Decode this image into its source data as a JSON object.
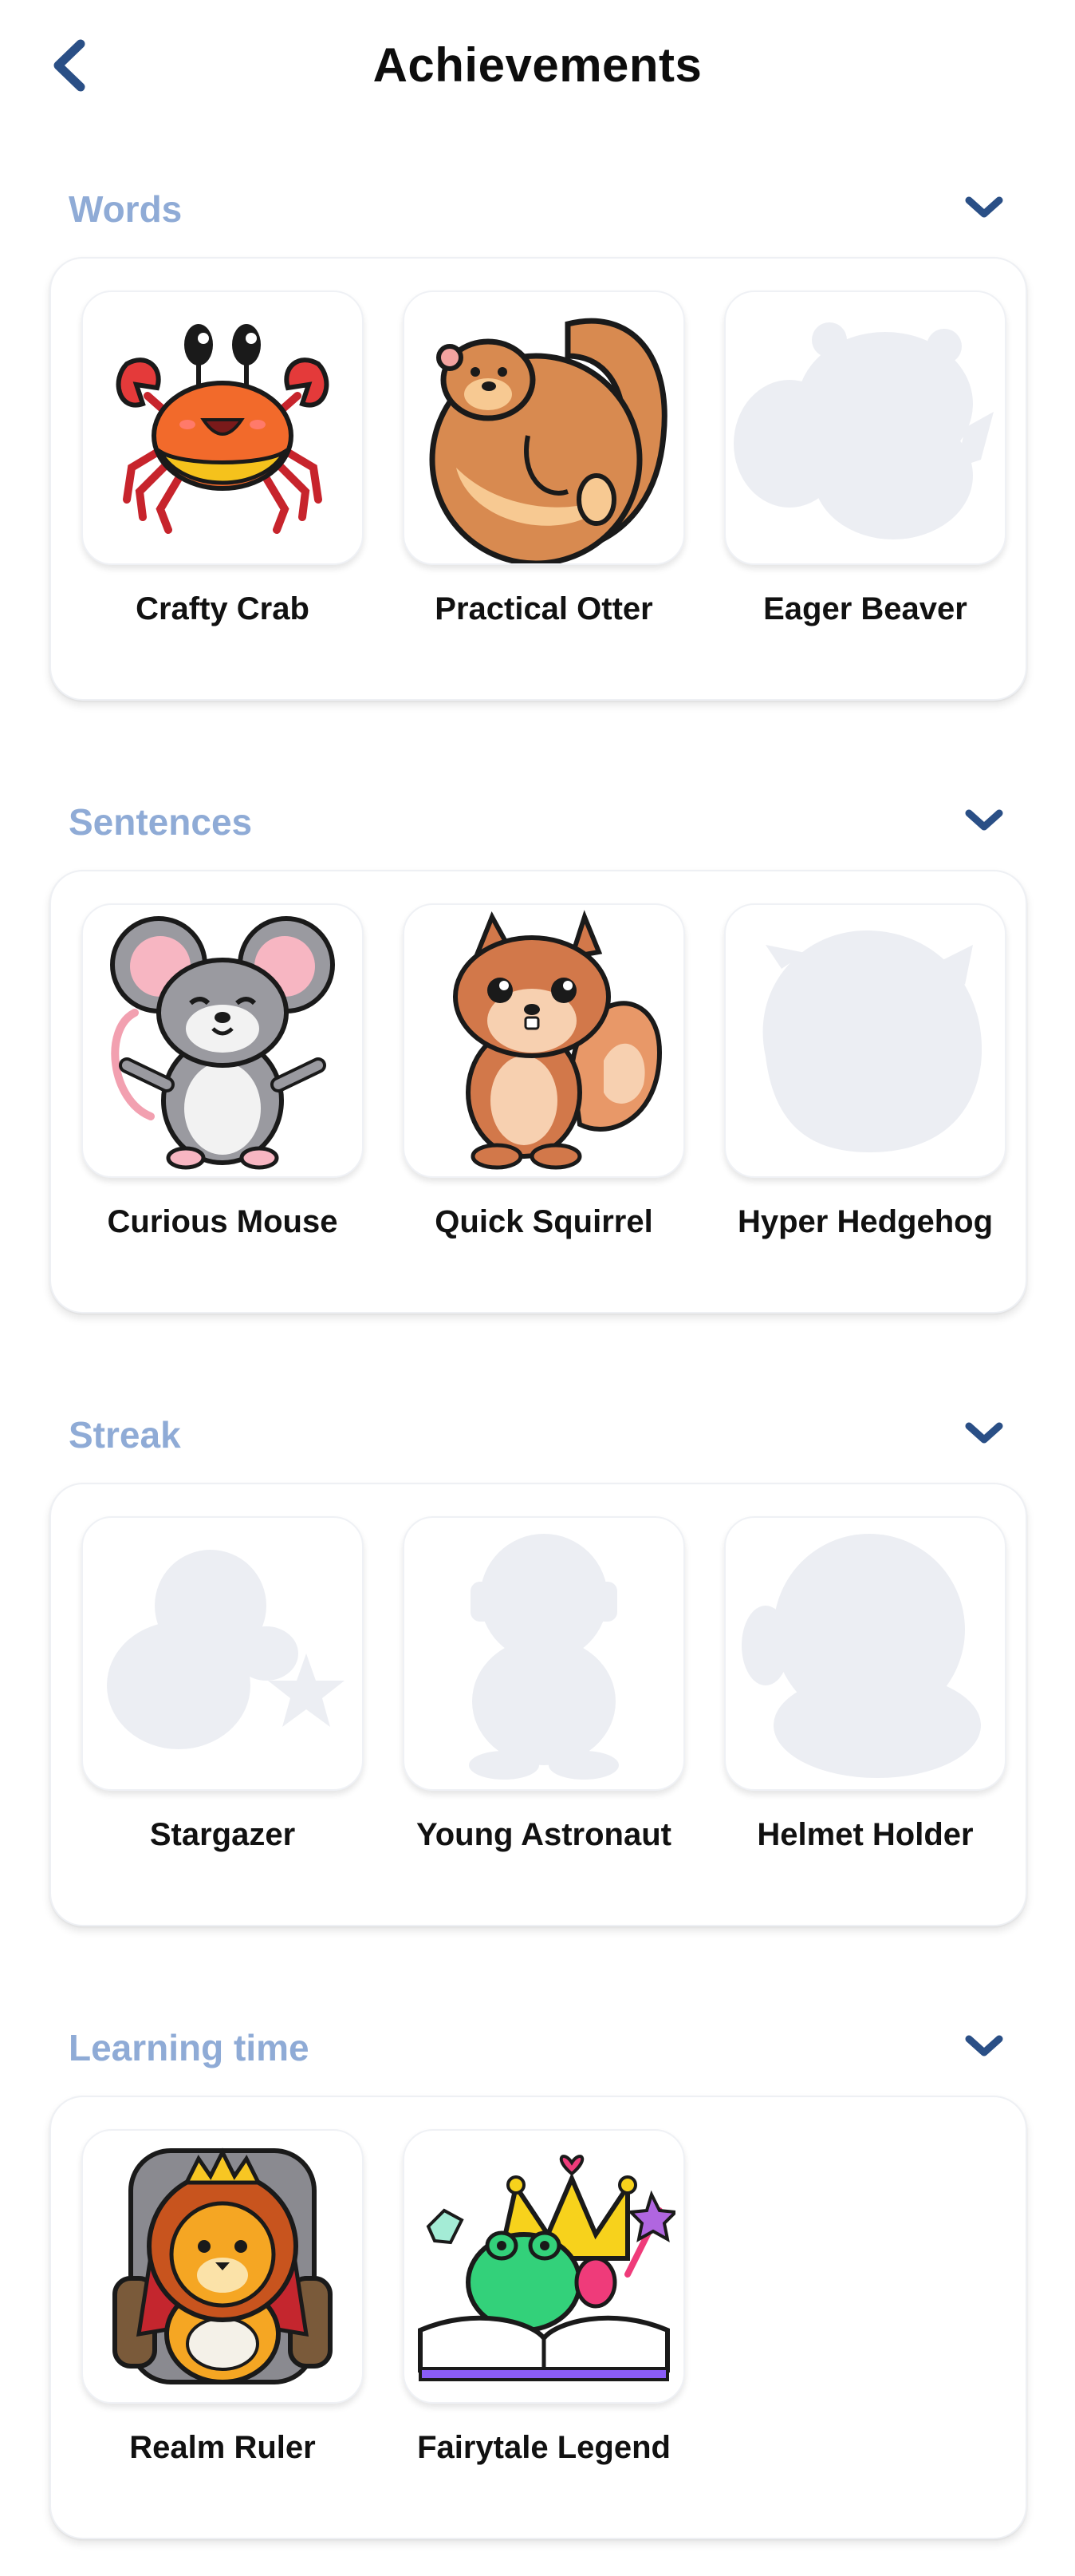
{
  "header": {
    "title": "Achievements",
    "back_icon": "chevron-left-icon"
  },
  "colors": {
    "accent": "#2a4f86",
    "section_title": "#8fabd6",
    "locked": "#eceef3"
  },
  "sections": [
    {
      "title": "Words",
      "badges": [
        {
          "label": "Crafty Crab",
          "icon": "crab-icon",
          "locked": false
        },
        {
          "label": "Practical Otter",
          "icon": "otter-icon",
          "locked": false
        },
        {
          "label": "Eager Beaver",
          "icon": "beaver-silhouette-icon",
          "locked": true
        }
      ]
    },
    {
      "title": "Sentences",
      "badges": [
        {
          "label": "Curious Mouse",
          "icon": "mouse-icon",
          "locked": false
        },
        {
          "label": "Quick Squirrel",
          "icon": "squirrel-icon",
          "locked": false
        },
        {
          "label": "Hyper Hedgehog",
          "icon": "hedgehog-silhouette-icon",
          "locked": true
        }
      ]
    },
    {
      "title": "Streak",
      "badges": [
        {
          "label": "Stargazer",
          "icon": "stargazer-silhouette-icon",
          "locked": true
        },
        {
          "label": "Young Astronaut",
          "icon": "astronaut-silhouette-icon",
          "locked": true
        },
        {
          "label": "Helmet Holder",
          "icon": "helmet-silhouette-icon",
          "locked": true
        }
      ]
    },
    {
      "title": "Learning time",
      "badges": [
        {
          "label": "Realm Ruler",
          "icon": "lion-king-icon",
          "locked": false
        },
        {
          "label": "Fairytale Legend",
          "icon": "fairytale-book-icon",
          "locked": false
        }
      ]
    }
  ]
}
